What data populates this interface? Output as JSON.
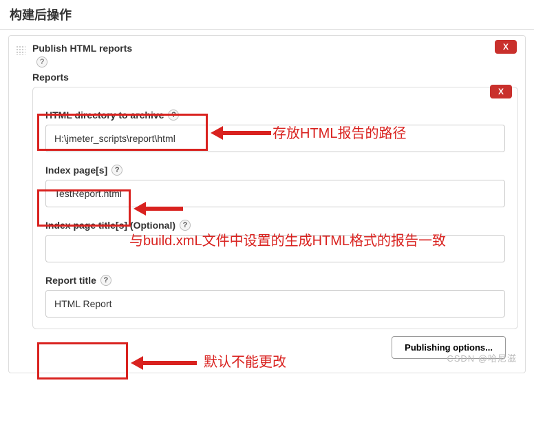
{
  "section_title": "构建后操作",
  "publish": {
    "title": "Publish HTML reports",
    "reports_label": "Reports",
    "delete1": "X",
    "delete2": "X",
    "fields": {
      "html_dir_label": "HTML directory to archive",
      "html_dir_value": "H:\\jmeter_scripts\\report\\html",
      "index_pages_label": "Index page[s]",
      "index_pages_value": "TestReport.html",
      "index_titles_label": "Index page title[s] (Optional)",
      "index_titles_value": "",
      "report_title_label": "Report title",
      "report_title_value": "HTML Report"
    }
  },
  "annotations": {
    "a1": "存放HTML报告的路径",
    "a2": "与build.xmL文件中设置的生成HTML格式的报告一致",
    "a3": "默认不能更改"
  },
  "footer": {
    "publishing_options": "Publishing options..."
  },
  "help": "?",
  "watermark": "CSDN @哈尼滋"
}
